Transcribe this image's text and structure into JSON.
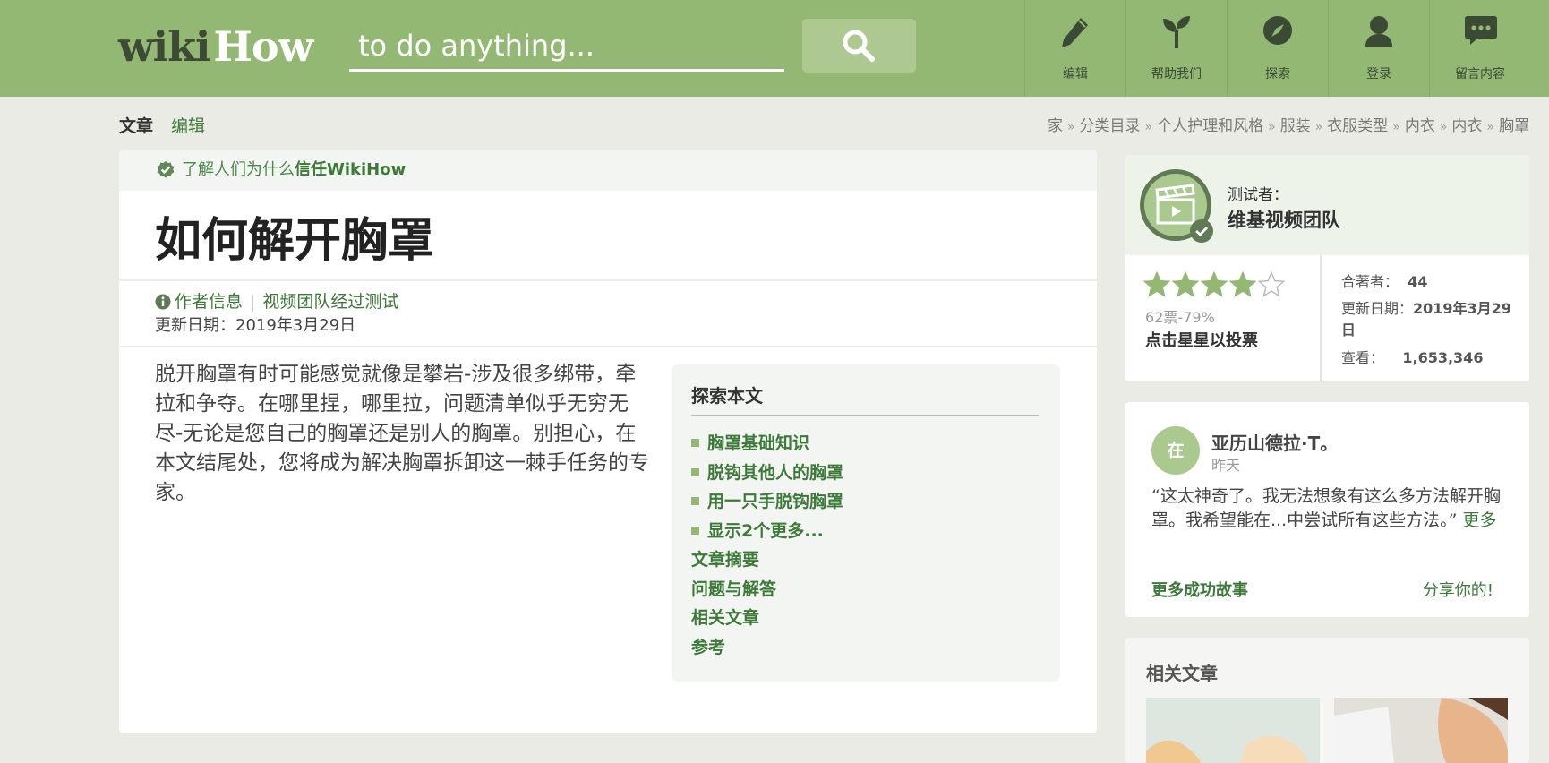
{
  "header": {
    "logo_wiki": "wiki",
    "logo_how": "How",
    "search_placeholder": "to do anything...",
    "nav": [
      {
        "label": "编辑",
        "icon": "pencil-icon"
      },
      {
        "label": "帮助我们",
        "icon": "sprout-icon"
      },
      {
        "label": "探索",
        "icon": "compass-icon"
      },
      {
        "label": "登录",
        "icon": "user-icon"
      },
      {
        "label": "留言内容",
        "icon": "chat-icon"
      }
    ]
  },
  "tabs": {
    "article": "文章",
    "edit": "编辑"
  },
  "breadcrumb": [
    "家",
    "分类目录",
    "个人护理和风格",
    "服装",
    "衣服类型",
    "内衣",
    "内衣",
    "胸罩"
  ],
  "breadcrumb_sep": "»",
  "article": {
    "trust_prefix": "了解人们为什么",
    "trust_bold": "信任WikiHow",
    "title": "如何解开胸罩",
    "author_info": "作者信息",
    "meta_divider": "|",
    "tested": "视频团队经过测试",
    "updated": "更新日期：2019年3月29日",
    "intro": "脱开胸罩有时可能感觉就像是攀岩-涉及很多绑带，牵拉和争夺。在哪里捏，哪里拉，问题清单似乎无穷无尽-无论是您自己的胸罩还是别人的胸罩。别担心，在本文结尾处，您将成为解决胸罩拆卸这一棘手任务的专家。"
  },
  "toc": {
    "title": "探索本文",
    "items": [
      {
        "label": "胸罩基础知识",
        "bullet": true
      },
      {
        "label": "脱钩其他人的胸罩",
        "bullet": true
      },
      {
        "label": "用一只手脱钩胸罩",
        "bullet": true
      },
      {
        "label": "显示2个更多...",
        "bullet": true
      },
      {
        "label": "文章摘要",
        "bullet": false
      },
      {
        "label": "问题与解答",
        "bullet": false
      },
      {
        "label": "相关文章",
        "bullet": false
      },
      {
        "label": "参考",
        "bullet": false
      }
    ]
  },
  "sidebar": {
    "tested_by_label": "测试者：",
    "tested_by_name": "维基视频团队",
    "rating": 4,
    "rating_max": 5,
    "votes": "62票-79%",
    "click_to_vote": "点击星星以投票",
    "coauthors_label": "合著者：",
    "coauthors_value": "44",
    "updated_label": "更新日期：",
    "updated_value": "2019年3月29日",
    "views_label": "查看：",
    "views_value": "1,653,346"
  },
  "story": {
    "avatar_text": "在",
    "name": "亚历山德拉·T。",
    "time": "昨天",
    "text": "“这太神奇了。我无法想象有这么多方法解开胸罩。我希望能在...中尝试所有这些方法。”",
    "more": "更多",
    "more_stories": "更多成功故事",
    "share": "分享你的!"
  },
  "related": {
    "title": "相关文章"
  },
  "colors": {
    "header_bg": "#93b874",
    "link_green": "#3d7a3a",
    "star": "#93b874",
    "page_bg": "#ebebe6"
  }
}
